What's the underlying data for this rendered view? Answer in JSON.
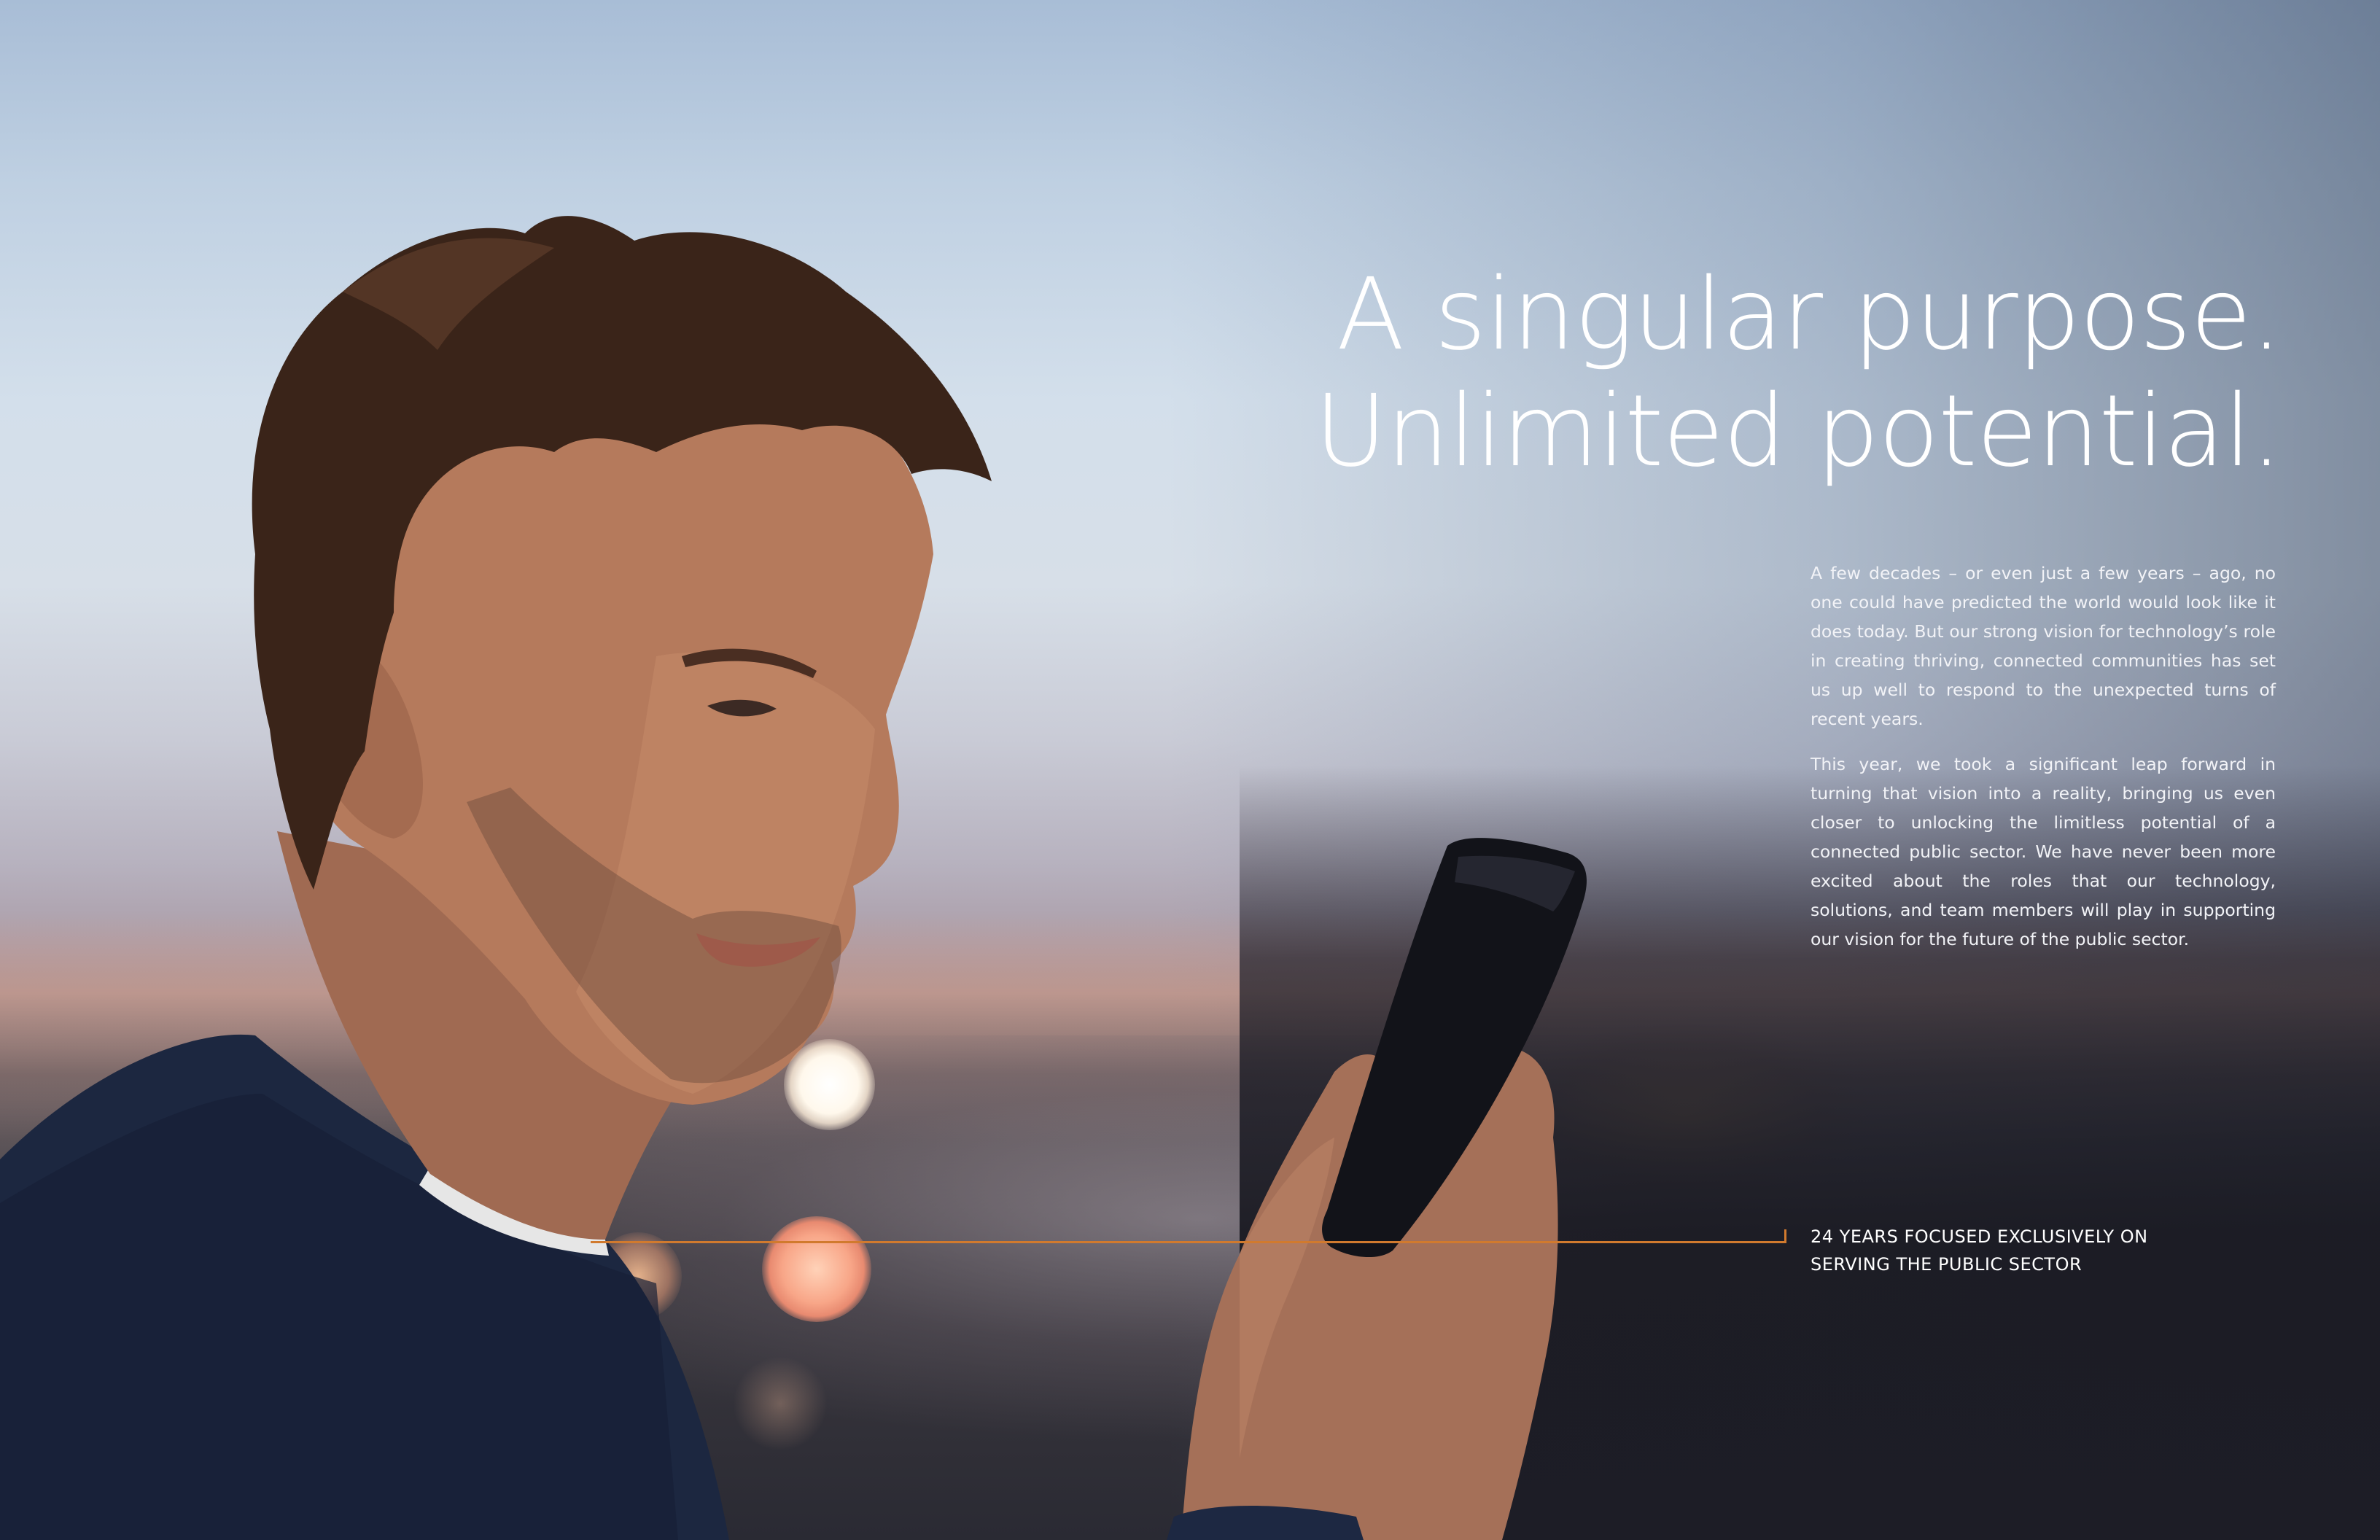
{
  "headline": {
    "line1": "A singular purpose.",
    "line2": "Unlimited potential."
  },
  "body": {
    "paragraph1": "A few decades – or even just a few years – ago, no one could have predicted the world would look like it does today. But our strong vision for technology’s role in creating thriving, connected communities has set us up well to respond to the unexpected turns of recent years.",
    "paragraph2": "This year, we took a significant leap forward in turning that vision into a reality, bringing us even closer to unlocking the limitless potential of a connected public sector. We have never been more excited about the roles that our technology, solutions, and team members will play in supporting our vision for the future of the public sector."
  },
  "tagline": {
    "line1": "24 YEARS FOCUSED EXCLUSIVELY ON",
    "line2": "SERVING THE PUBLIC SECTOR"
  },
  "colors": {
    "accent_rule": "#d17a2e",
    "text": "#ffffff"
  }
}
